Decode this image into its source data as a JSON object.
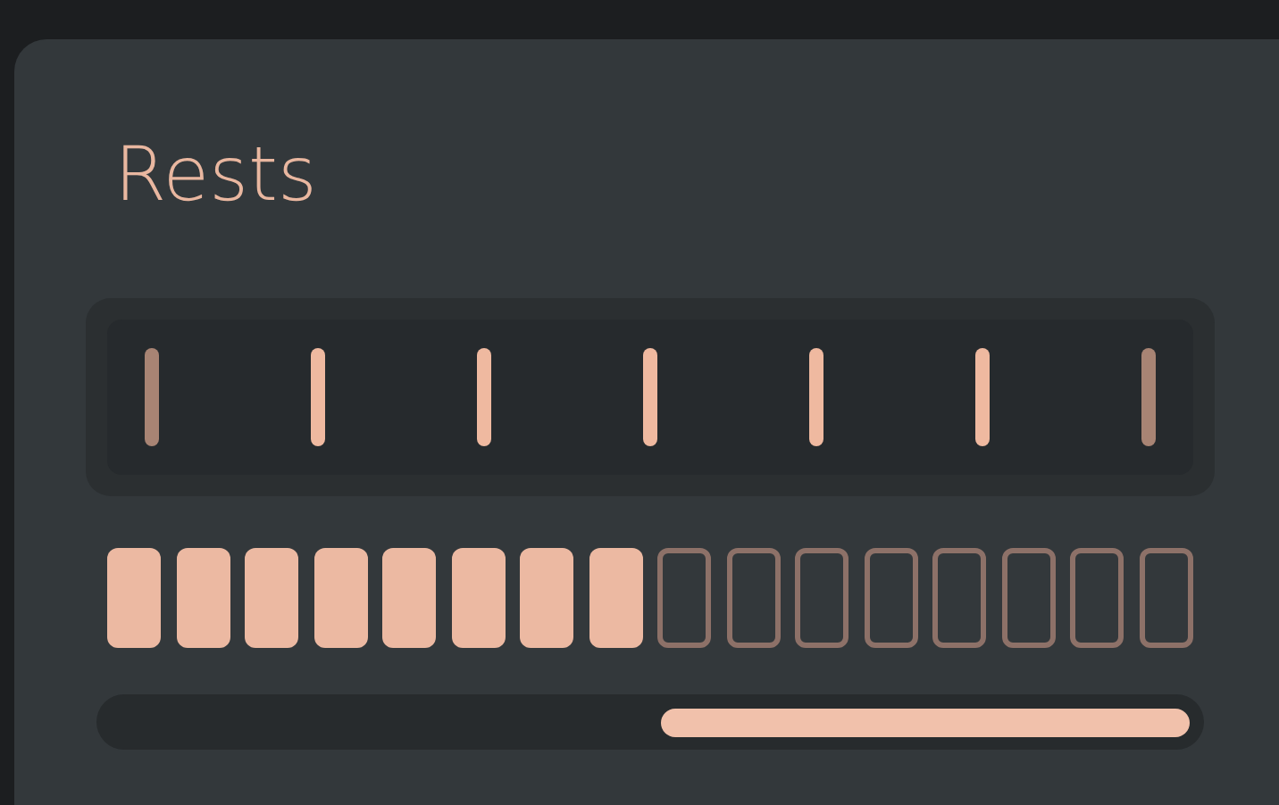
{
  "title": "Rests",
  "ticks": [
    {
      "dimmed": true
    },
    {
      "dimmed": false
    },
    {
      "dimmed": false
    },
    {
      "dimmed": false
    },
    {
      "dimmed": false
    },
    {
      "dimmed": false
    },
    {
      "dimmed": true
    }
  ],
  "blocks": [
    {
      "filled": true
    },
    {
      "filled": true
    },
    {
      "filled": true
    },
    {
      "filled": true
    },
    {
      "filled": true
    },
    {
      "filled": true
    },
    {
      "filled": true
    },
    {
      "filled": true
    },
    {
      "filled": false
    },
    {
      "filled": false
    },
    {
      "filled": false
    },
    {
      "filled": false
    },
    {
      "filled": false
    },
    {
      "filled": false
    },
    {
      "filled": false
    },
    {
      "filled": false
    }
  ]
}
